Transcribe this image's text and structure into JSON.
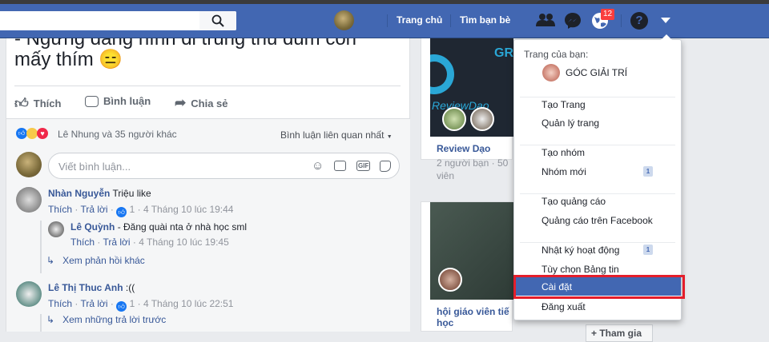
{
  "nav": {
    "home": "Trang chủ",
    "find_friends": "Tìm bạn bè",
    "notif_count": "12",
    "color": "#4267b2"
  },
  "post": {
    "text_line1": "- Ngừng đăng hình đi trùng thủ đum con",
    "text_line2": "mấy thím 😑",
    "actions": {
      "like": "Thích",
      "comment": "Bình luận",
      "share": "Chia sẻ"
    },
    "reactions_text": "Lê Nhung và 35 người khác",
    "sort": "Bình luận liên quan nhất",
    "comment_placeholder": "Viết bình luận..."
  },
  "comments": [
    {
      "name": "Nhàn Nguyễn",
      "text": "Triệu like",
      "like": "Thích",
      "reply": "Trả lời",
      "likes": "1",
      "time": "4 Tháng 10 lúc 19:44",
      "reply_item": {
        "name": "Lê Quỳnh",
        "text": "- Đăng quài nta ở nhà học sml",
        "like": "Thích",
        "reply": "Trả lời",
        "time": "4 Tháng 10 lúc 19:45"
      },
      "more": "Xem phản hồi khác"
    },
    {
      "name": "Lê Thị Thuc Anh",
      "text": ":((",
      "like": "Thích",
      "reply": "Trả lời",
      "likes": "1",
      "time": "4 Tháng 10 lúc 22:51",
      "more": "Xem những trả lời trước"
    }
  ],
  "groups": [
    {
      "name": "Review Dạo",
      "meta": "2 người bạn · 50",
      "meta2": "viên",
      "logo": "ReviewDao"
    },
    {
      "name": "hội giáo viên tiế",
      "name2": "học",
      "join": "+ Tham gia"
    }
  ],
  "menu": {
    "your_pages": "Trang của bạn:",
    "page_name": "GÓC GIẢI TRÍ",
    "items": [
      "Tạo Trang",
      "Quản lý trang",
      "Tạo nhóm",
      "Nhóm mới",
      "Tạo quảng cáo",
      "Quảng cáo trên Facebook",
      "Nhật ký hoạt động",
      "Tùy chọn Bảng tin",
      "Cài đặt",
      "Đăng xuất"
    ],
    "badge_new_groups": "1",
    "badge_activity": "1",
    "selected": "Cài đặt",
    "highlight_color": "#e41e2b"
  }
}
